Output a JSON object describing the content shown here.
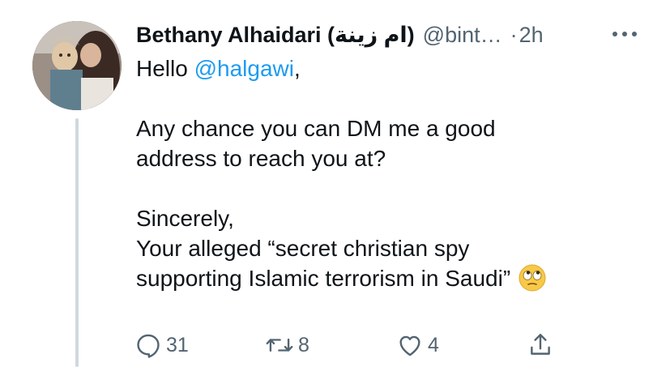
{
  "tweet": {
    "author_name": "Bethany Alhaidari (ام زينة)",
    "handle": "@bint…",
    "separator": "·",
    "timestamp": "2h",
    "body": {
      "greeting_prefix": "Hello ",
      "mention": "@halgawi",
      "greeting_suffix": ",",
      "line1": "Any chance you can DM me a good",
      "line2": "address to reach you at?",
      "line3": "Sincerely,",
      "line4": "Your alleged “secret christian spy",
      "line5": "supporting Islamic terrorism in Saudi”",
      "emoji": "face-with-rolling-eyes"
    },
    "actions": {
      "reply_count": "31",
      "retweet_count": "8",
      "like_count": "4"
    }
  },
  "colors": {
    "text": "#0f1419",
    "secondary": "#536471",
    "link": "#1d9bf0",
    "thread_line": "#cfd9de"
  }
}
